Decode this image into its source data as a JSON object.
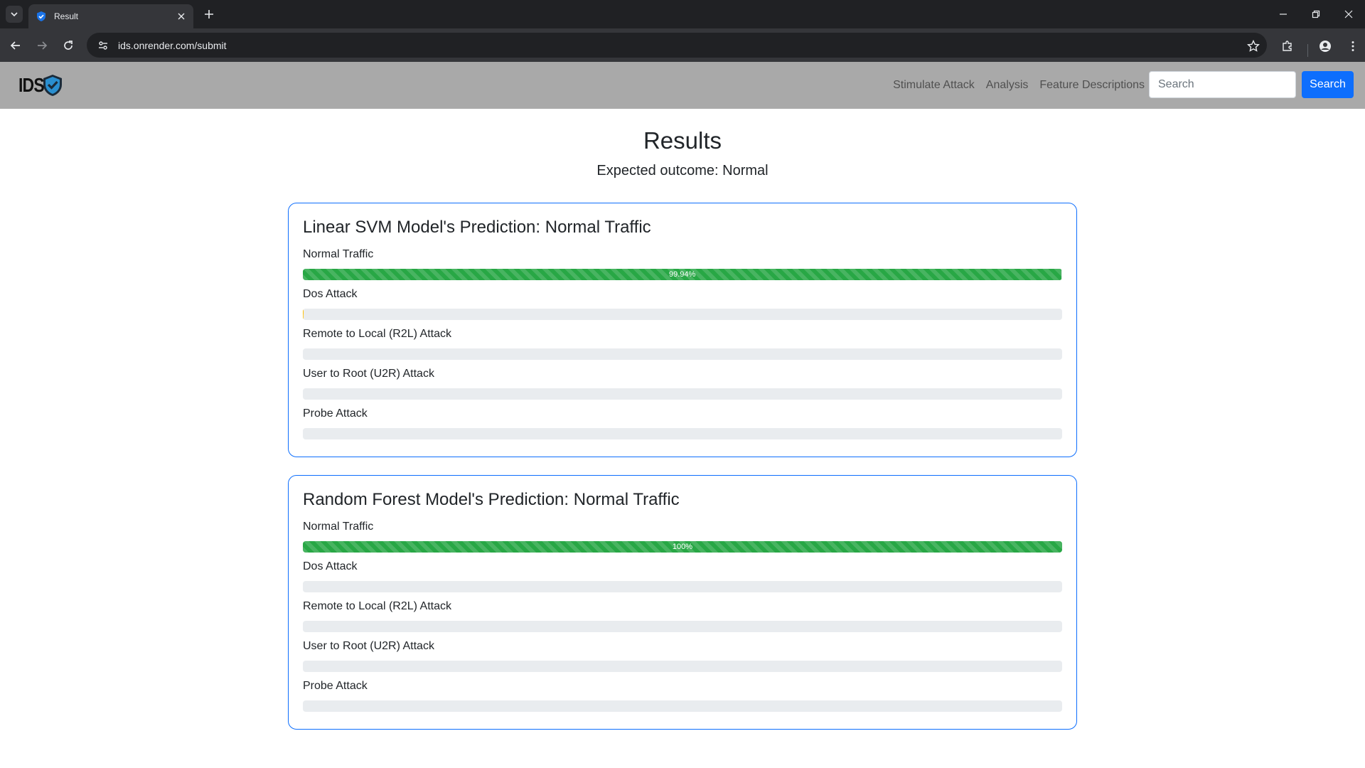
{
  "browser": {
    "tab_title": "Result",
    "url": "ids.onrender.com/submit"
  },
  "navbar": {
    "logo_text": "IDS",
    "links": [
      "Stimulate Attack",
      "Analysis",
      "Feature Descriptions"
    ],
    "search_placeholder": "Search",
    "search_button": "Search"
  },
  "page": {
    "title": "Results",
    "expected": "Expected outcome: Normal"
  },
  "cards": [
    {
      "title": "Linear SVM Model's Prediction: Normal Traffic",
      "rows": [
        {
          "label": "Normal Traffic",
          "percent": 99.94,
          "text": "99.94%"
        },
        {
          "label": "Dos Attack",
          "percent": 0.06,
          "text": ""
        },
        {
          "label": "Remote to Local (R2L) Attack",
          "percent": 0,
          "text": ""
        },
        {
          "label": "User to Root (U2R) Attack",
          "percent": 0,
          "text": ""
        },
        {
          "label": "Probe Attack",
          "percent": 0,
          "text": ""
        }
      ]
    },
    {
      "title": "Random Forest Model's Prediction: Normal Traffic",
      "rows": [
        {
          "label": "Normal Traffic",
          "percent": 100,
          "text": "100%"
        },
        {
          "label": "Dos Attack",
          "percent": 0,
          "text": ""
        },
        {
          "label": "Remote to Local (R2L) Attack",
          "percent": 0,
          "text": ""
        },
        {
          "label": "User to Root (U2R) Attack",
          "percent": 0,
          "text": ""
        },
        {
          "label": "Probe Attack",
          "percent": 0,
          "text": ""
        }
      ]
    }
  ],
  "colors": {
    "accent": "#0d6efd",
    "success": "#28a745",
    "warning": "#ffc107",
    "navbar_bg": "#a9a9a9"
  },
  "icons": {
    "logo": "shield-check-icon",
    "tab_favicon": "shield-check-icon"
  }
}
